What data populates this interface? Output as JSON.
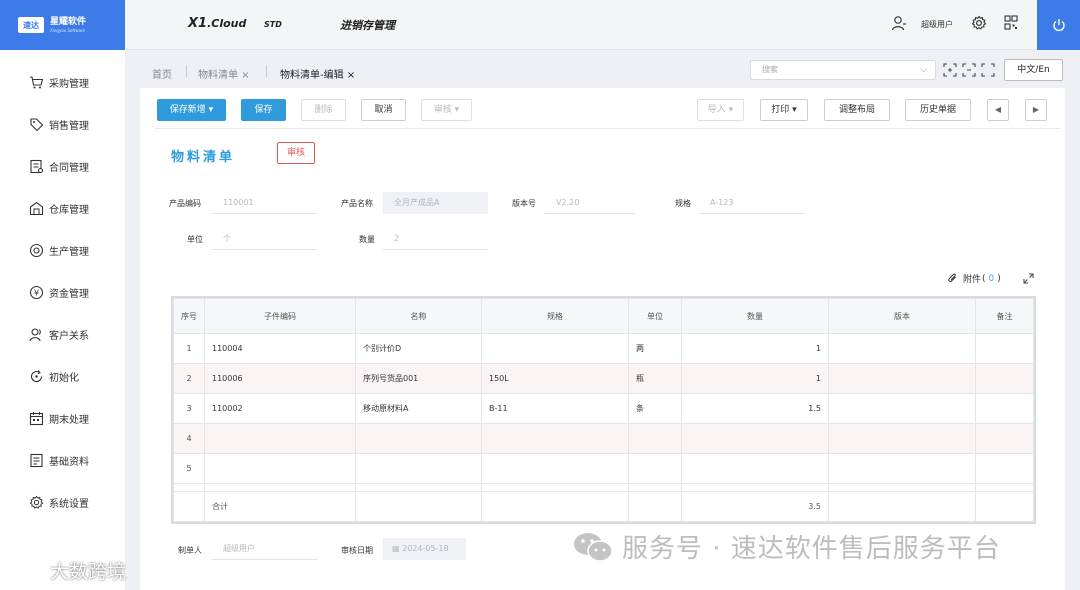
{
  "header": {
    "brand_mark": "速达",
    "brand_cn": "星耀软件",
    "brand_en": "Xingyao Software",
    "product": "X1",
    "product_suffix": ".Cloud",
    "edition": "STD",
    "module": "进销存管理",
    "user": "超级用户"
  },
  "sidebar": {
    "items": [
      {
        "label": "采购管理",
        "icon": "cart-icon"
      },
      {
        "label": "销售管理",
        "icon": "tag-icon"
      },
      {
        "label": "合同管理",
        "icon": "contract-icon"
      },
      {
        "label": "仓库管理",
        "icon": "warehouse-icon"
      },
      {
        "label": "生产管理",
        "icon": "production-icon"
      },
      {
        "label": "资金管理",
        "icon": "money-icon"
      },
      {
        "label": "客户关系",
        "icon": "customer-icon"
      },
      {
        "label": "初始化",
        "icon": "init-icon"
      },
      {
        "label": "期末处理",
        "icon": "calendar-icon"
      },
      {
        "label": "基础资料",
        "icon": "document-icon"
      },
      {
        "label": "系统设置",
        "icon": "settings-icon"
      }
    ]
  },
  "tabs": [
    {
      "label": "首页"
    },
    {
      "label": "物料清单",
      "close": "×"
    },
    {
      "label": "物料清单-编辑",
      "close": "×"
    }
  ],
  "search": {
    "placeholder": "搜索"
  },
  "lang": "中文/En",
  "toolbar": {
    "save_new": "保存新增",
    "save_new_caret": "▾",
    "save": "保存",
    "delete": "删除",
    "cancel": "取消",
    "audit": "审核",
    "audit_caret": "▾",
    "import": "导入",
    "import_caret": "▾",
    "print": "打印",
    "print_caret": "▾",
    "layout": "调整布局",
    "history": "历史单据",
    "prev": "◀",
    "next": "▶"
  },
  "form": {
    "title": "物料清单",
    "status": "审核",
    "fields": {
      "product_code": {
        "label": "产品编码",
        "value": "110001"
      },
      "product_name": {
        "label": "产品名称",
        "value": "全月产成品A"
      },
      "version": {
        "label": "版本号",
        "value": "V2.20"
      },
      "spec": {
        "label": "规格",
        "value": "A-123"
      },
      "unit": {
        "label": "单位",
        "value": "个"
      },
      "quantity": {
        "label": "数量",
        "value": "2"
      }
    },
    "attachment": {
      "label": "附件",
      "open": "(",
      "count": "0",
      "close": ")"
    }
  },
  "table": {
    "headers": [
      "序号",
      "子件编码",
      "名称",
      "规格",
      "单位",
      "数量",
      "版本",
      "备注"
    ],
    "rows": [
      {
        "no": "1",
        "code": "110004",
        "name": "个别计价D",
        "spec": "",
        "unit": "两",
        "qty": "1",
        "version": "",
        "note": ""
      },
      {
        "no": "2",
        "code": "110006",
        "name": "序列号货品001",
        "spec": "150L",
        "unit": "瓶",
        "qty": "1",
        "version": "",
        "note": ""
      },
      {
        "no": "3",
        "code": "110002",
        "name": "移动原材料A",
        "spec": "B-11",
        "unit": "条",
        "qty": "1.5",
        "version": "",
        "note": ""
      },
      {
        "no": "4",
        "code": "",
        "name": "",
        "spec": "",
        "unit": "",
        "qty": "",
        "version": "",
        "note": ""
      },
      {
        "no": "5",
        "code": "",
        "name": "",
        "spec": "",
        "unit": "",
        "qty": "",
        "version": "",
        "note": ""
      }
    ],
    "total_label": "合计",
    "total_qty": "3.5"
  },
  "footer": {
    "maker_label": "制单人",
    "maker_value": "超级用户",
    "audit_date_label": "审核日期",
    "audit_date_value": "2024-05-18"
  },
  "watermarks": {
    "right": "服务号 · 速达软件售后服务平台",
    "left": "大数跨境"
  }
}
